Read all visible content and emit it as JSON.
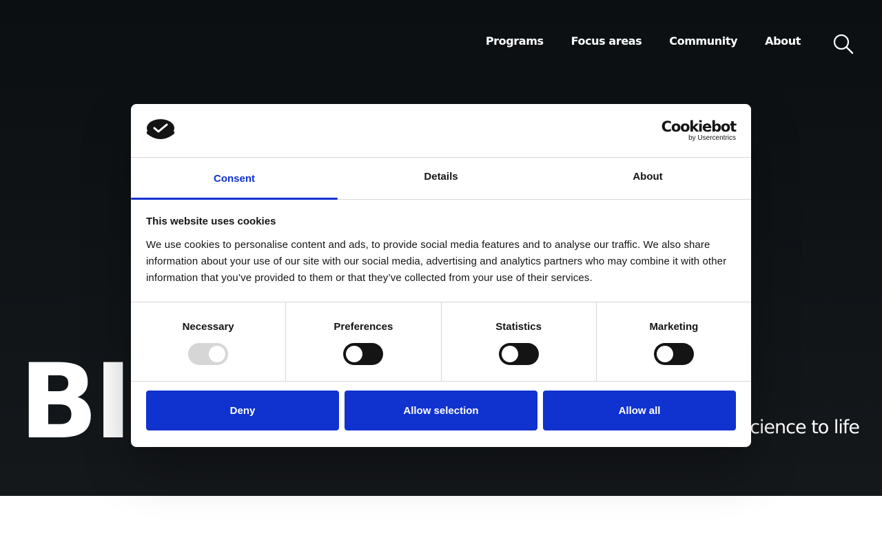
{
  "nav": {
    "items": [
      {
        "label": "Programs"
      },
      {
        "label": "Focus areas"
      },
      {
        "label": "Community"
      },
      {
        "label": "About"
      }
    ],
    "search_icon": "search-icon"
  },
  "hero": {
    "logo_partial": "BII",
    "tagline_partial": "science to life"
  },
  "cookie_dialog": {
    "brand_icon": "cookie-icon",
    "provider_name": "Cookiebot",
    "provider_sub": "by Usercentrics",
    "tabs": [
      {
        "label": "Consent",
        "active": true
      },
      {
        "label": "Details",
        "active": false
      },
      {
        "label": "About",
        "active": false
      }
    ],
    "title": "This website uses cookies",
    "body": "We use cookies to personalise content and ads, to provide social media features and to analyse our traffic. We also share information about your use of our site with our social media, advertising and analytics partners who may combine it with other information that you’ve provided to them or that they’ve collected from your use of their services.",
    "categories": [
      {
        "label": "Necessary",
        "enabled": true,
        "locked": true
      },
      {
        "label": "Preferences",
        "enabled": false,
        "locked": false
      },
      {
        "label": "Statistics",
        "enabled": false,
        "locked": false
      },
      {
        "label": "Marketing",
        "enabled": false,
        "locked": false
      }
    ],
    "buttons": {
      "deny": "Deny",
      "allow_selection": "Allow selection",
      "allow_all": "Allow all"
    },
    "colors": {
      "accent": "#1032cf",
      "toggle_off": "#141414",
      "toggle_locked": "#d6d6d6"
    }
  }
}
